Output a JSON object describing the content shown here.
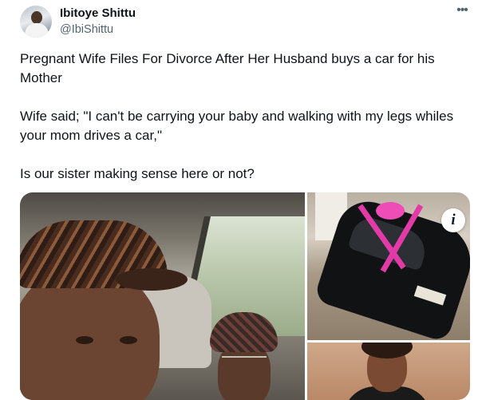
{
  "author": {
    "name": "Ibitoye Shittu",
    "handle": "@IbiShittu",
    "avatar_icon": "profile-photo"
  },
  "menu": {
    "more_icon": "more-horizontal-icon",
    "more_glyph": "•••"
  },
  "tweet": {
    "paragraphs": [
      "Pregnant Wife Files For Divorce After Her Husband buys a car for his Mother",
      "Wife said; \"I can't be carrying your baby and walking with my legs whiles your mom drives a car,\"",
      "Is our sister making sense here or not?"
    ]
  },
  "media": {
    "info_badge": "i",
    "images": [
      {
        "description_icon": "selfie-in-car-photo"
      },
      {
        "description_icon": "car-with-ribbon-photo"
      },
      {
        "description_icon": "woman-portrait-photo"
      }
    ]
  },
  "colors": {
    "text_primary": "#0f1419",
    "text_secondary": "#536471",
    "ribbon": "#e23aa6"
  }
}
